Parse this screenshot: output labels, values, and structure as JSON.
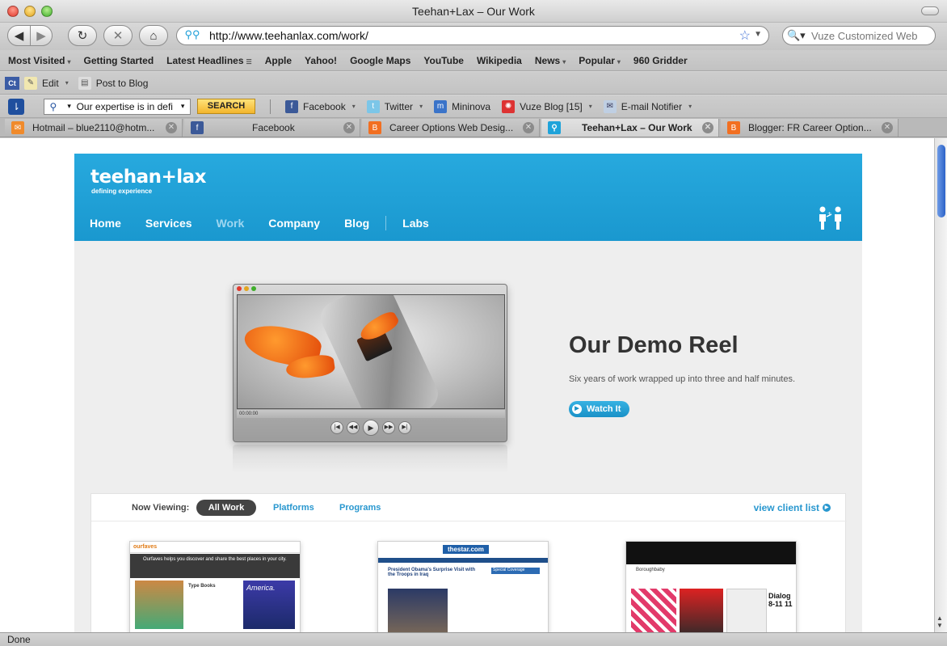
{
  "window": {
    "title": "Teehan+Lax – Our Work"
  },
  "navigation": {
    "url": "http://www.teehanlax.com/work/",
    "search_placeholder": "Vuze Customized Web"
  },
  "bookmarks": [
    {
      "label": "Most Visited",
      "dropdown": true
    },
    {
      "label": "Getting Started"
    },
    {
      "label": "Latest Headlines",
      "rss": true
    },
    {
      "label": "Apple"
    },
    {
      "label": "Yahoo!"
    },
    {
      "label": "Google Maps"
    },
    {
      "label": "YouTube"
    },
    {
      "label": "Wikipedia"
    },
    {
      "label": "News",
      "dropdown": true
    },
    {
      "label": "Popular",
      "dropdown": true
    },
    {
      "label": "960 Gridder"
    }
  ],
  "toolbar2": {
    "ct": "Ct",
    "edit": "Edit",
    "post": "Post to Blog"
  },
  "toolbar3": {
    "search_value": "Our expertise is in defi",
    "search_button": "SEARCH",
    "items": [
      "Facebook",
      "Twitter",
      "Mininova",
      "Vuze Blog [15]",
      "E-mail Notifier"
    ]
  },
  "tabs": [
    {
      "label": "Hotmail – blue2110@hotm...",
      "icon": "hotmail-icon"
    },
    {
      "label": "Facebook",
      "icon": "facebook-icon"
    },
    {
      "label": "Career Options Web Desig...",
      "icon": "blogger-icon"
    },
    {
      "label": "Teehan+Lax – Our Work",
      "icon": "teehanlax-icon",
      "active": true
    },
    {
      "label": "Blogger: FR Career Option...",
      "icon": "blogger-icon"
    }
  ],
  "status": "Done",
  "site": {
    "logo": "teehan+lax",
    "tagline": "defining experience",
    "nav": [
      "Home",
      "Services",
      "Work",
      "Company",
      "Blog",
      "Labs"
    ],
    "current_nav": "Work",
    "player": {
      "time": "00:00:00"
    },
    "demo_title": "Our Demo Reel",
    "demo_subtitle": "Six years of work wrapped up into three and half minutes.",
    "watch_label": "Watch It",
    "filter": {
      "now_viewing": "Now Viewing:",
      "active": "All Work",
      "links": [
        "Platforms",
        "Programs"
      ],
      "client_list": "view client list"
    },
    "thumbnails": [
      {
        "name": "ourfaves",
        "label": "ourfaves",
        "headline": "Ourfaves helps you discover and share the best places in your city.",
        "section": "Type Books",
        "promo": "America."
      },
      {
        "name": "thestar",
        "label": "thestar.com",
        "headline": "President Obama's Surprise Visit with the Troops in Iraq",
        "section": "Special Coverage"
      },
      {
        "name": "boroughbaby",
        "label": "Boroughbaby",
        "headline": "Dialog 8-11 11"
      }
    ]
  },
  "colors": {
    "brand_blue": "#1fa3da",
    "link_blue": "#2897cf",
    "nav_current": "#9fd7f1"
  }
}
